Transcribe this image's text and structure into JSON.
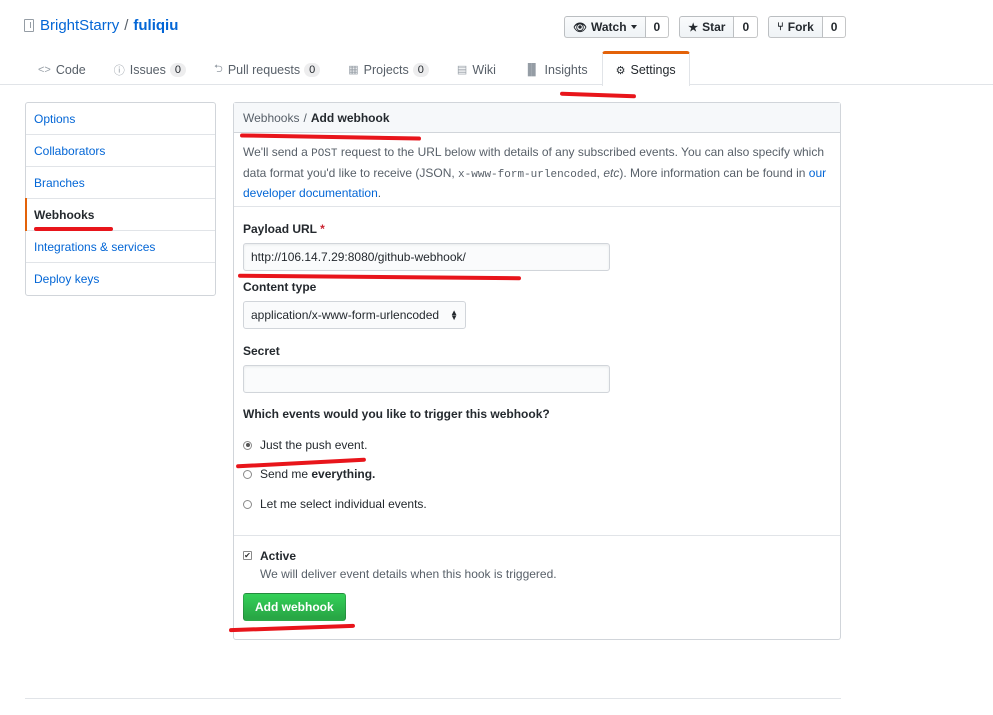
{
  "repo": {
    "owner": "BrightStarry",
    "separator": "/",
    "name": "fuliqiu"
  },
  "actions": [
    {
      "label": "Watch",
      "count": "0",
      "icon": "eye-icon"
    },
    {
      "label": "Star",
      "count": "0",
      "icon": "star-icon"
    },
    {
      "label": "Fork",
      "count": "0",
      "icon": "fork-icon"
    }
  ],
  "nav": {
    "code": "Code",
    "issues": "Issues",
    "issues_count": "0",
    "pulls": "Pull requests",
    "pulls_count": "0",
    "projects": "Projects",
    "projects_count": "0",
    "wiki": "Wiki",
    "insights": "Insights",
    "settings": "Settings"
  },
  "sidebar": {
    "items": [
      {
        "label": "Options"
      },
      {
        "label": "Collaborators"
      },
      {
        "label": "Branches"
      },
      {
        "label": "Webhooks"
      },
      {
        "label": "Integrations & services"
      },
      {
        "label": "Deploy keys"
      }
    ]
  },
  "breadcrumb": {
    "parent": "Webhooks",
    "separator": "/",
    "current": "Add webhook"
  },
  "intro": {
    "p1": "We'll send a ",
    "code1": "POST",
    "p2": " request to the URL below with details of any subscribed events. You can also specify which data format you'd like to receive (JSON, ",
    "code2": "x-www-form-urlencoded",
    "p3": ", ",
    "etc": "etc",
    "p4": "). More information can be found in ",
    "link": "our developer documentation",
    "p5": "."
  },
  "form": {
    "payload_label": "Payload URL",
    "required_mark": "*",
    "payload_value": "http://106.14.7.29:8080/github-webhook/",
    "content_type_label": "Content type",
    "content_type_value": "application/x-www-form-urlencoded",
    "secret_label": "Secret",
    "secret_value": "",
    "events_question": "Which events would you like to trigger this webhook?",
    "event_push": "Just the push event.",
    "event_everything_prefix": "Send me ",
    "event_everything_em": "everything.",
    "event_individual": "Let me select individual events.",
    "active_label": "Active",
    "active_note": "We will deliver event details when this hook is triggered.",
    "submit": "Add webhook"
  },
  "colors": {
    "accent": "#e36209",
    "link": "#0366d6",
    "primary": "#28a745",
    "annotation": "#e8151b"
  }
}
